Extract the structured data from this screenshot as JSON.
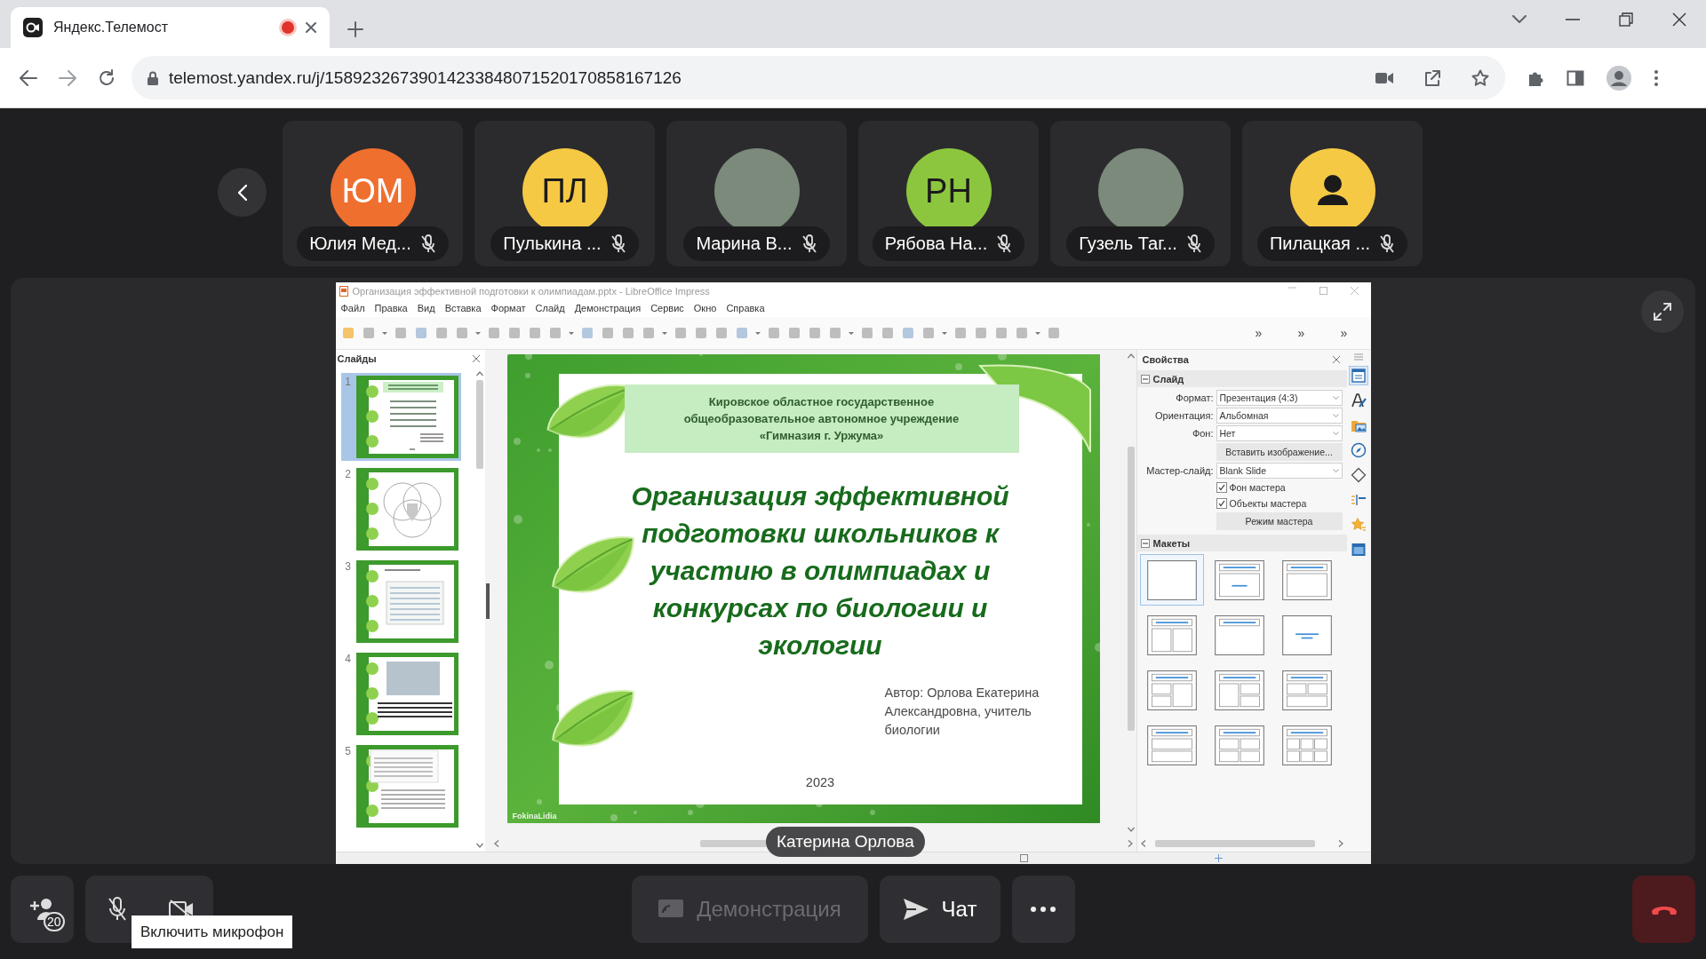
{
  "browser": {
    "tab": {
      "title": "Яндекс.Телемост",
      "recording": true
    },
    "url": "telemost.yandex.ru/j/15892326739014233848071520170858167126"
  },
  "participants": [
    {
      "name": "Юлия Мед...",
      "muted": true,
      "avatar": {
        "kind": "initials",
        "initials": "ЮМ",
        "color": "#ef6f2e"
      }
    },
    {
      "name": "Пулькина ...",
      "muted": true,
      "avatar": {
        "kind": "initials",
        "initials": "ПЛ",
        "color": "#f6c945"
      }
    },
    {
      "name": "Марина В...",
      "muted": true,
      "avatar": {
        "kind": "photo"
      }
    },
    {
      "name": "Рябова На...",
      "muted": true,
      "avatar": {
        "kind": "initials",
        "initials": "РН",
        "color": "#8cc63e"
      }
    },
    {
      "name": "Гузель Таг...",
      "muted": true,
      "avatar": {
        "kind": "photo"
      }
    },
    {
      "name": "Пилацкая ...",
      "muted": true,
      "avatar": {
        "kind": "icon",
        "color": "#f6c945"
      }
    }
  ],
  "screen_share": {
    "presenter": "Катерина Орлова",
    "window": {
      "title": "Организация эффективной подготовки к олимпиадам.pptx - LibreOffice Impress",
      "menu": [
        "Файл",
        "Правка",
        "Вид",
        "Вставка",
        "Формат",
        "Слайд",
        "Демонстрация",
        "Сервис",
        "Окно",
        "Справка"
      ],
      "toolbar_overflow": [
        "»",
        "»",
        "»"
      ],
      "slides_panel": {
        "title": "Слайды",
        "slides": [
          {
            "number": "1",
            "kind": "title",
            "selected": true
          },
          {
            "number": "2",
            "kind": "diagram",
            "selected": false
          },
          {
            "number": "3",
            "kind": "table",
            "selected": false
          },
          {
            "number": "4",
            "kind": "photo",
            "selected": false
          },
          {
            "number": "5",
            "kind": "text",
            "selected": false
          }
        ]
      },
      "slide": {
        "header": [
          "Кировское областное государственное",
          "общеобразовательное автономное учреждение",
          "«Гимназия г. Уржума»"
        ],
        "title": [
          "Организация эффективной",
          "подготовки школьников к",
          "участию в олимпиадах и",
          "конкурсах по биологии и",
          "экологии"
        ],
        "author": [
          "Автор: Орлова Екатерина",
          "Александровна, учитель",
          "биологии"
        ],
        "year": "2023",
        "credit": "FokinaLidia"
      },
      "properties": {
        "title": "Свойства",
        "slide_section": {
          "title": "Слайд",
          "fields": [
            {
              "label": "Формат:",
              "value": "Презентация (4:3)"
            },
            {
              "label": "Ориентация:",
              "value": "Альбомная"
            },
            {
              "label": "Фон:",
              "value": "Нет"
            }
          ],
          "insert_image_button": "Вставить изображение...",
          "master_field": {
            "label": "Мастер-слайд:",
            "value": "Blank Slide"
          },
          "checkboxes": [
            {
              "label": "Фон мастера",
              "checked": true
            },
            {
              "label": "Объекты мастера",
              "checked": true
            }
          ],
          "master_mode_button": "Режим мастера"
        },
        "layouts_section": {
          "title": "Макеты",
          "layouts": [
            {
              "kind": "blank",
              "selected": true
            },
            {
              "kind": "title-subtitle",
              "selected": false
            },
            {
              "kind": "title-content",
              "selected": false
            },
            {
              "kind": "title-2content",
              "selected": false
            },
            {
              "kind": "title-only",
              "selected": false
            },
            {
              "kind": "centered-text",
              "selected": false
            },
            {
              "kind": "title-2content-content",
              "selected": false
            },
            {
              "kind": "title-content-2content",
              "selected": false
            },
            {
              "kind": "title-2content-over-content",
              "selected": false
            },
            {
              "kind": "title-content-over-content",
              "selected": false
            },
            {
              "kind": "title-4content",
              "selected": false
            },
            {
              "kind": "title-6content",
              "selected": false
            }
          ]
        }
      },
      "sidebar_tabs": [
        {
          "kind": "properties",
          "selected": true
        },
        {
          "kind": "styles",
          "selected": false
        },
        {
          "kind": "gallery",
          "selected": false
        },
        {
          "kind": "navigator",
          "selected": false
        },
        {
          "kind": "shapes",
          "selected": false
        },
        {
          "kind": "animation",
          "selected": false
        },
        {
          "kind": "transition",
          "selected": false
        },
        {
          "kind": "master-slides",
          "selected": false
        }
      ]
    }
  },
  "controls": {
    "invite_count": "20",
    "mic": {
      "on": false
    },
    "camera": {
      "on": false
    },
    "tooltip": "Включить микрофон",
    "screen_share_button": {
      "label": "Демонстрация",
      "disabled": true
    },
    "chat_button": {
      "label": "Чат"
    }
  }
}
